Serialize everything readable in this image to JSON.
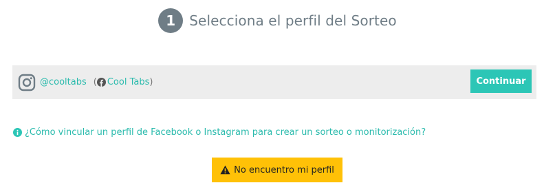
{
  "step": {
    "number": "1",
    "title": "Selecciona el perfil del Sorteo"
  },
  "profile": {
    "instagram_icon": "instagram-icon",
    "instagram_handle": "@cooltabs",
    "paren_open": "(",
    "facebook_icon": "facebook-icon",
    "facebook_name": "Cool Tabs",
    "paren_close": ")",
    "continue_label": "Continuar"
  },
  "help": {
    "icon": "info-icon",
    "text": "¿Cómo vincular un perfil de Facebook o Instagram para crear un sorteo o monitorización?"
  },
  "not_found": {
    "icon": "warning-icon",
    "label": "No encuentro mi perfil"
  },
  "colors": {
    "accent": "#2cc6b6",
    "link": "#2bbbad",
    "warning": "#ffc107",
    "step_gray": "#6f7d86",
    "bar_bg": "#ededed"
  }
}
